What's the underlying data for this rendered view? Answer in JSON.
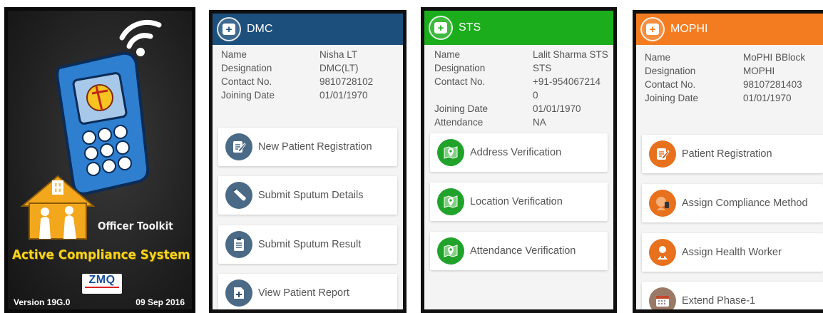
{
  "splash": {
    "officer_label": "Officer Toolkit",
    "title": "Active Compliance System",
    "logo_text": "ZMQ",
    "version": "Version 19G.0",
    "date": "09 Sep 2016"
  },
  "dmc": {
    "title": "DMC",
    "color": "#1d4f7c",
    "info": [
      {
        "label": "Name",
        "value": "Nisha LT"
      },
      {
        "label": "Designation",
        "value": "DMC(LT)"
      },
      {
        "label": "Contact No.",
        "value": "9810728102"
      },
      {
        "label": "Joining Date",
        "value": "01/01/1970"
      }
    ],
    "actions": [
      {
        "label": "New Patient Registration",
        "icon": "edit-form-icon"
      },
      {
        "label": "Submit Sputum Details",
        "icon": "test-tube-icon"
      },
      {
        "label": "Submit Sputum Result",
        "icon": "report-list-icon"
      },
      {
        "label": "View Patient Report",
        "icon": "document-add-icon"
      }
    ]
  },
  "sts": {
    "title": "STS",
    "color": "#1cad1c",
    "info": [
      {
        "label": "Name",
        "value": "Lalit Sharma STS"
      },
      {
        "label": "Designation",
        "value": "STS"
      },
      {
        "label": "Contact No.",
        "value": "+91-954067214"
      },
      {
        "label": "",
        "value": "0"
      },
      {
        "label": "Joining Date",
        "value": "01/01/1970"
      },
      {
        "label": "Attendance",
        "value": "NA"
      }
    ],
    "actions": [
      {
        "label": "Address Verification",
        "icon": "map-pin-icon"
      },
      {
        "label": "Location Verification",
        "icon": "map-pin-icon"
      },
      {
        "label": "Attendance Verification",
        "icon": "map-pin-icon"
      }
    ]
  },
  "mophi": {
    "title": "MOPHI",
    "color": "#f47c20",
    "info": [
      {
        "label": "Name",
        "value": "MoPHI BBlock"
      },
      {
        "label": "Designation",
        "value": "MOPHI"
      },
      {
        "label": "Contact No.",
        "value": "98107281403"
      },
      {
        "label": "Joining Date",
        "value": "01/01/1970"
      }
    ],
    "actions": [
      {
        "label": "Patient Registration",
        "icon": "edit-form-icon"
      },
      {
        "label": "Assign Compliance Method",
        "icon": "person-phone-icon"
      },
      {
        "label": "Assign Health Worker",
        "icon": "health-worker-icon"
      },
      {
        "label": "Extend Phase-1",
        "icon": "calendar-icon"
      }
    ]
  }
}
